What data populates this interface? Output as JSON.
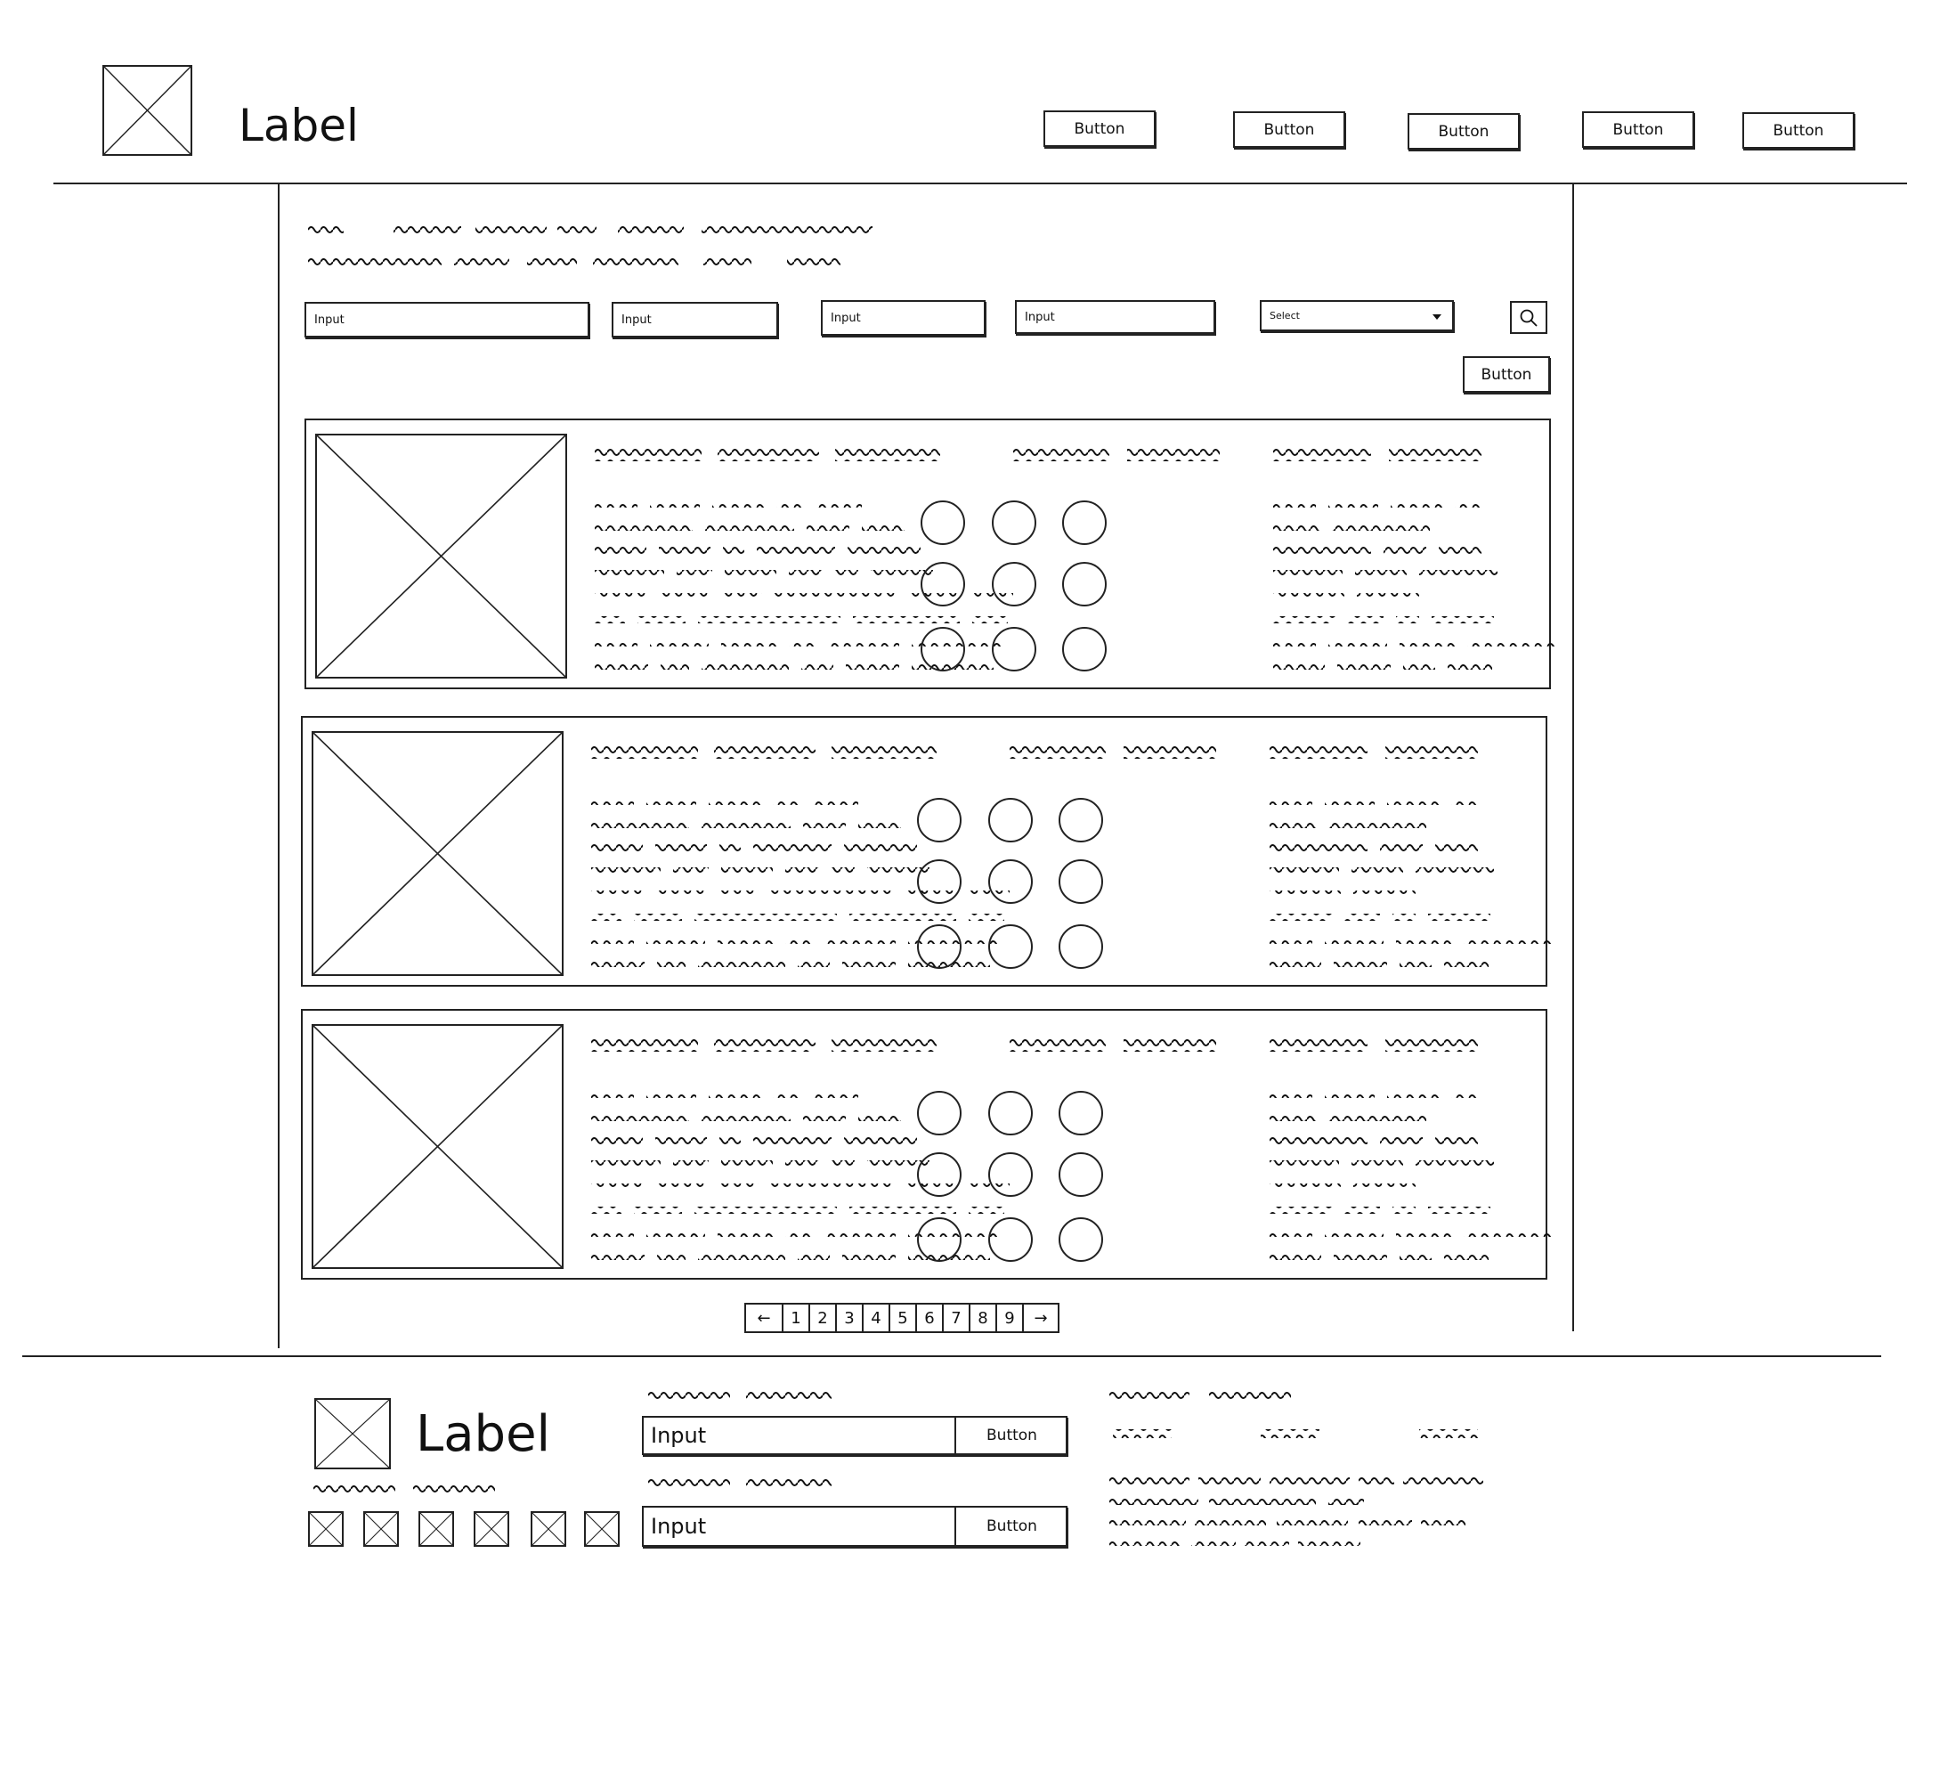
{
  "header": {
    "logo_icon": "placeholder-image-icon",
    "label": "Label",
    "nav_buttons": [
      "Button",
      "Button",
      "Button",
      "Button",
      "Button"
    ]
  },
  "filters": {
    "inputs": [
      "Input",
      "Input",
      "Input",
      "Input"
    ],
    "select": "Select",
    "search_icon": "search-icon",
    "action_button": "Button"
  },
  "pagination": {
    "prev_icon": "arrow-left-icon",
    "pages": [
      "1",
      "2",
      "3",
      "4",
      "5",
      "6",
      "7",
      "8",
      "9"
    ],
    "next_icon": "arrow-right-icon"
  },
  "footer": {
    "label": "Label",
    "forms": [
      {
        "input": "Input",
        "button": "Button"
      },
      {
        "input": "Input",
        "button": "Button"
      }
    ],
    "social_icons": [
      "placeholder-icon",
      "placeholder-icon",
      "placeholder-icon",
      "placeholder-icon",
      "placeholder-icon",
      "placeholder-icon"
    ]
  }
}
